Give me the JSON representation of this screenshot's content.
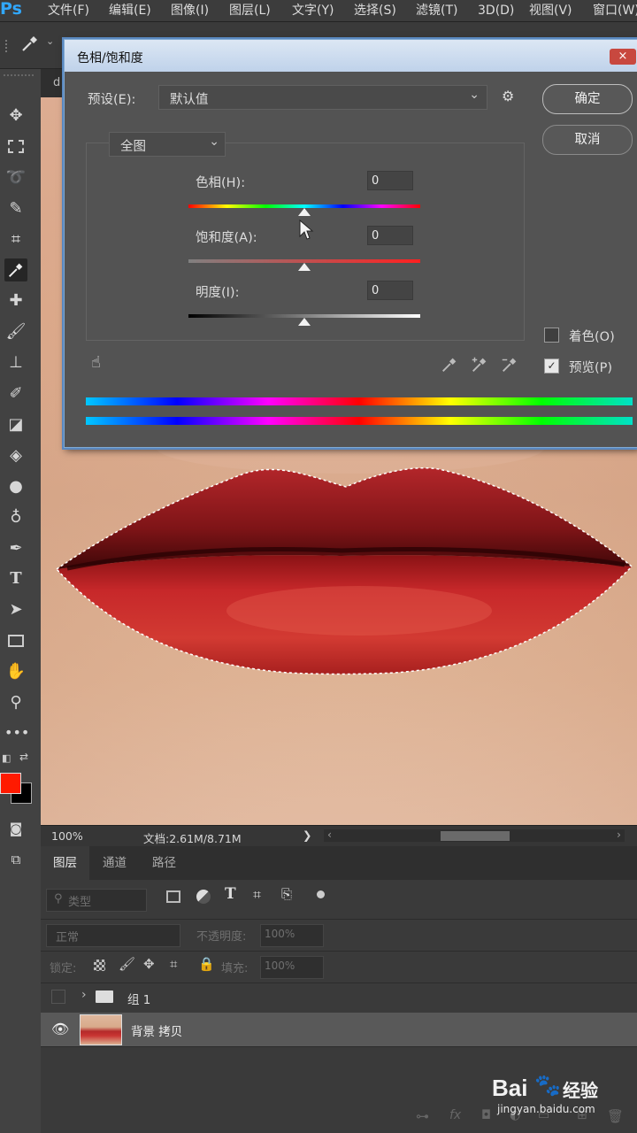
{
  "menubar": {
    "logo": "Ps",
    "items": [
      "文件(F)",
      "编辑(E)",
      "图像(I)",
      "图层(L)",
      "文字(Y)",
      "选择(S)",
      "滤镜(T)",
      "3D(D)",
      "视图(V)",
      "窗口(W)"
    ]
  },
  "document": {
    "tab_label": "d"
  },
  "colors": {
    "foreground": "#ff1a00",
    "background": "#000000",
    "accent": "#31a8ff"
  },
  "dialog": {
    "title": "色相/饱和度",
    "close": "×",
    "preset_label": "预设(E):",
    "preset_value": "默认值",
    "channel_value": "全图",
    "hue_label": "色相(H):",
    "hue_value": "0",
    "saturation_label": "饱和度(A):",
    "saturation_value": "0",
    "lightness_label": "明度(I):",
    "lightness_value": "0",
    "ok_label": "确定",
    "cancel_label": "取消",
    "colorize_label": "着色(O)",
    "colorize_checked": false,
    "preview_label": "预览(P)",
    "preview_checked": true
  },
  "statusbar": {
    "zoom": "100%",
    "doc_size": "文档:2.61M/8.71M",
    "arrow": "❯",
    "scroll_left": "‹",
    "scroll_right": "›"
  },
  "layers_panel": {
    "tabs": [
      "图层",
      "通道",
      "路径"
    ],
    "filter_placeholder": "类型",
    "blend_mode": "正常",
    "opacity_label": "不透明度:",
    "opacity_value": "100%",
    "lock_label": "锁定:",
    "fill_label": "填充:",
    "fill_value": "100%",
    "layers": [
      {
        "name": "组 1",
        "type": "group",
        "visible": false
      },
      {
        "name": "背景 拷贝",
        "type": "pixel",
        "visible": true,
        "selected": true
      }
    ]
  },
  "watermark": {
    "brand": "Bai",
    "brand2": "经验",
    "url": "jingyan.baidu.com"
  }
}
